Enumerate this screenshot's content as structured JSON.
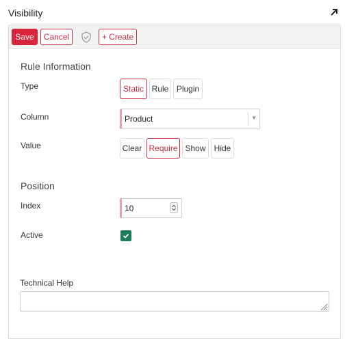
{
  "window": {
    "title": "Visibility"
  },
  "toolbar": {
    "save_label": "Save",
    "cancel_label": "Cancel",
    "create_label": "+ Create"
  },
  "rule_info": {
    "heading": "Rule Information",
    "type": {
      "label": "Type",
      "options": [
        "Static",
        "Rule",
        "Plugin"
      ],
      "selected": "Static"
    },
    "column": {
      "label": "Column",
      "value": "Product"
    },
    "value": {
      "label": "Value",
      "options": [
        "Clear",
        "Require",
        "Show",
        "Hide"
      ],
      "selected": "Require"
    }
  },
  "position": {
    "heading": "Position",
    "index": {
      "label": "Index",
      "value": "10"
    },
    "active": {
      "label": "Active",
      "checked": true
    }
  },
  "technical_help": {
    "label": "Technical Help",
    "value": ""
  },
  "colors": {
    "accent": "#d9253c",
    "accent_text": "#c62d3f",
    "checkbox": "#1c7d5c",
    "required_marker": "#e8a0aa"
  },
  "icons": [
    "expand-arrow-icon",
    "shield-icon",
    "chevron-down-icon",
    "spinner-icon",
    "check-icon",
    "resize-grip-icon"
  ]
}
